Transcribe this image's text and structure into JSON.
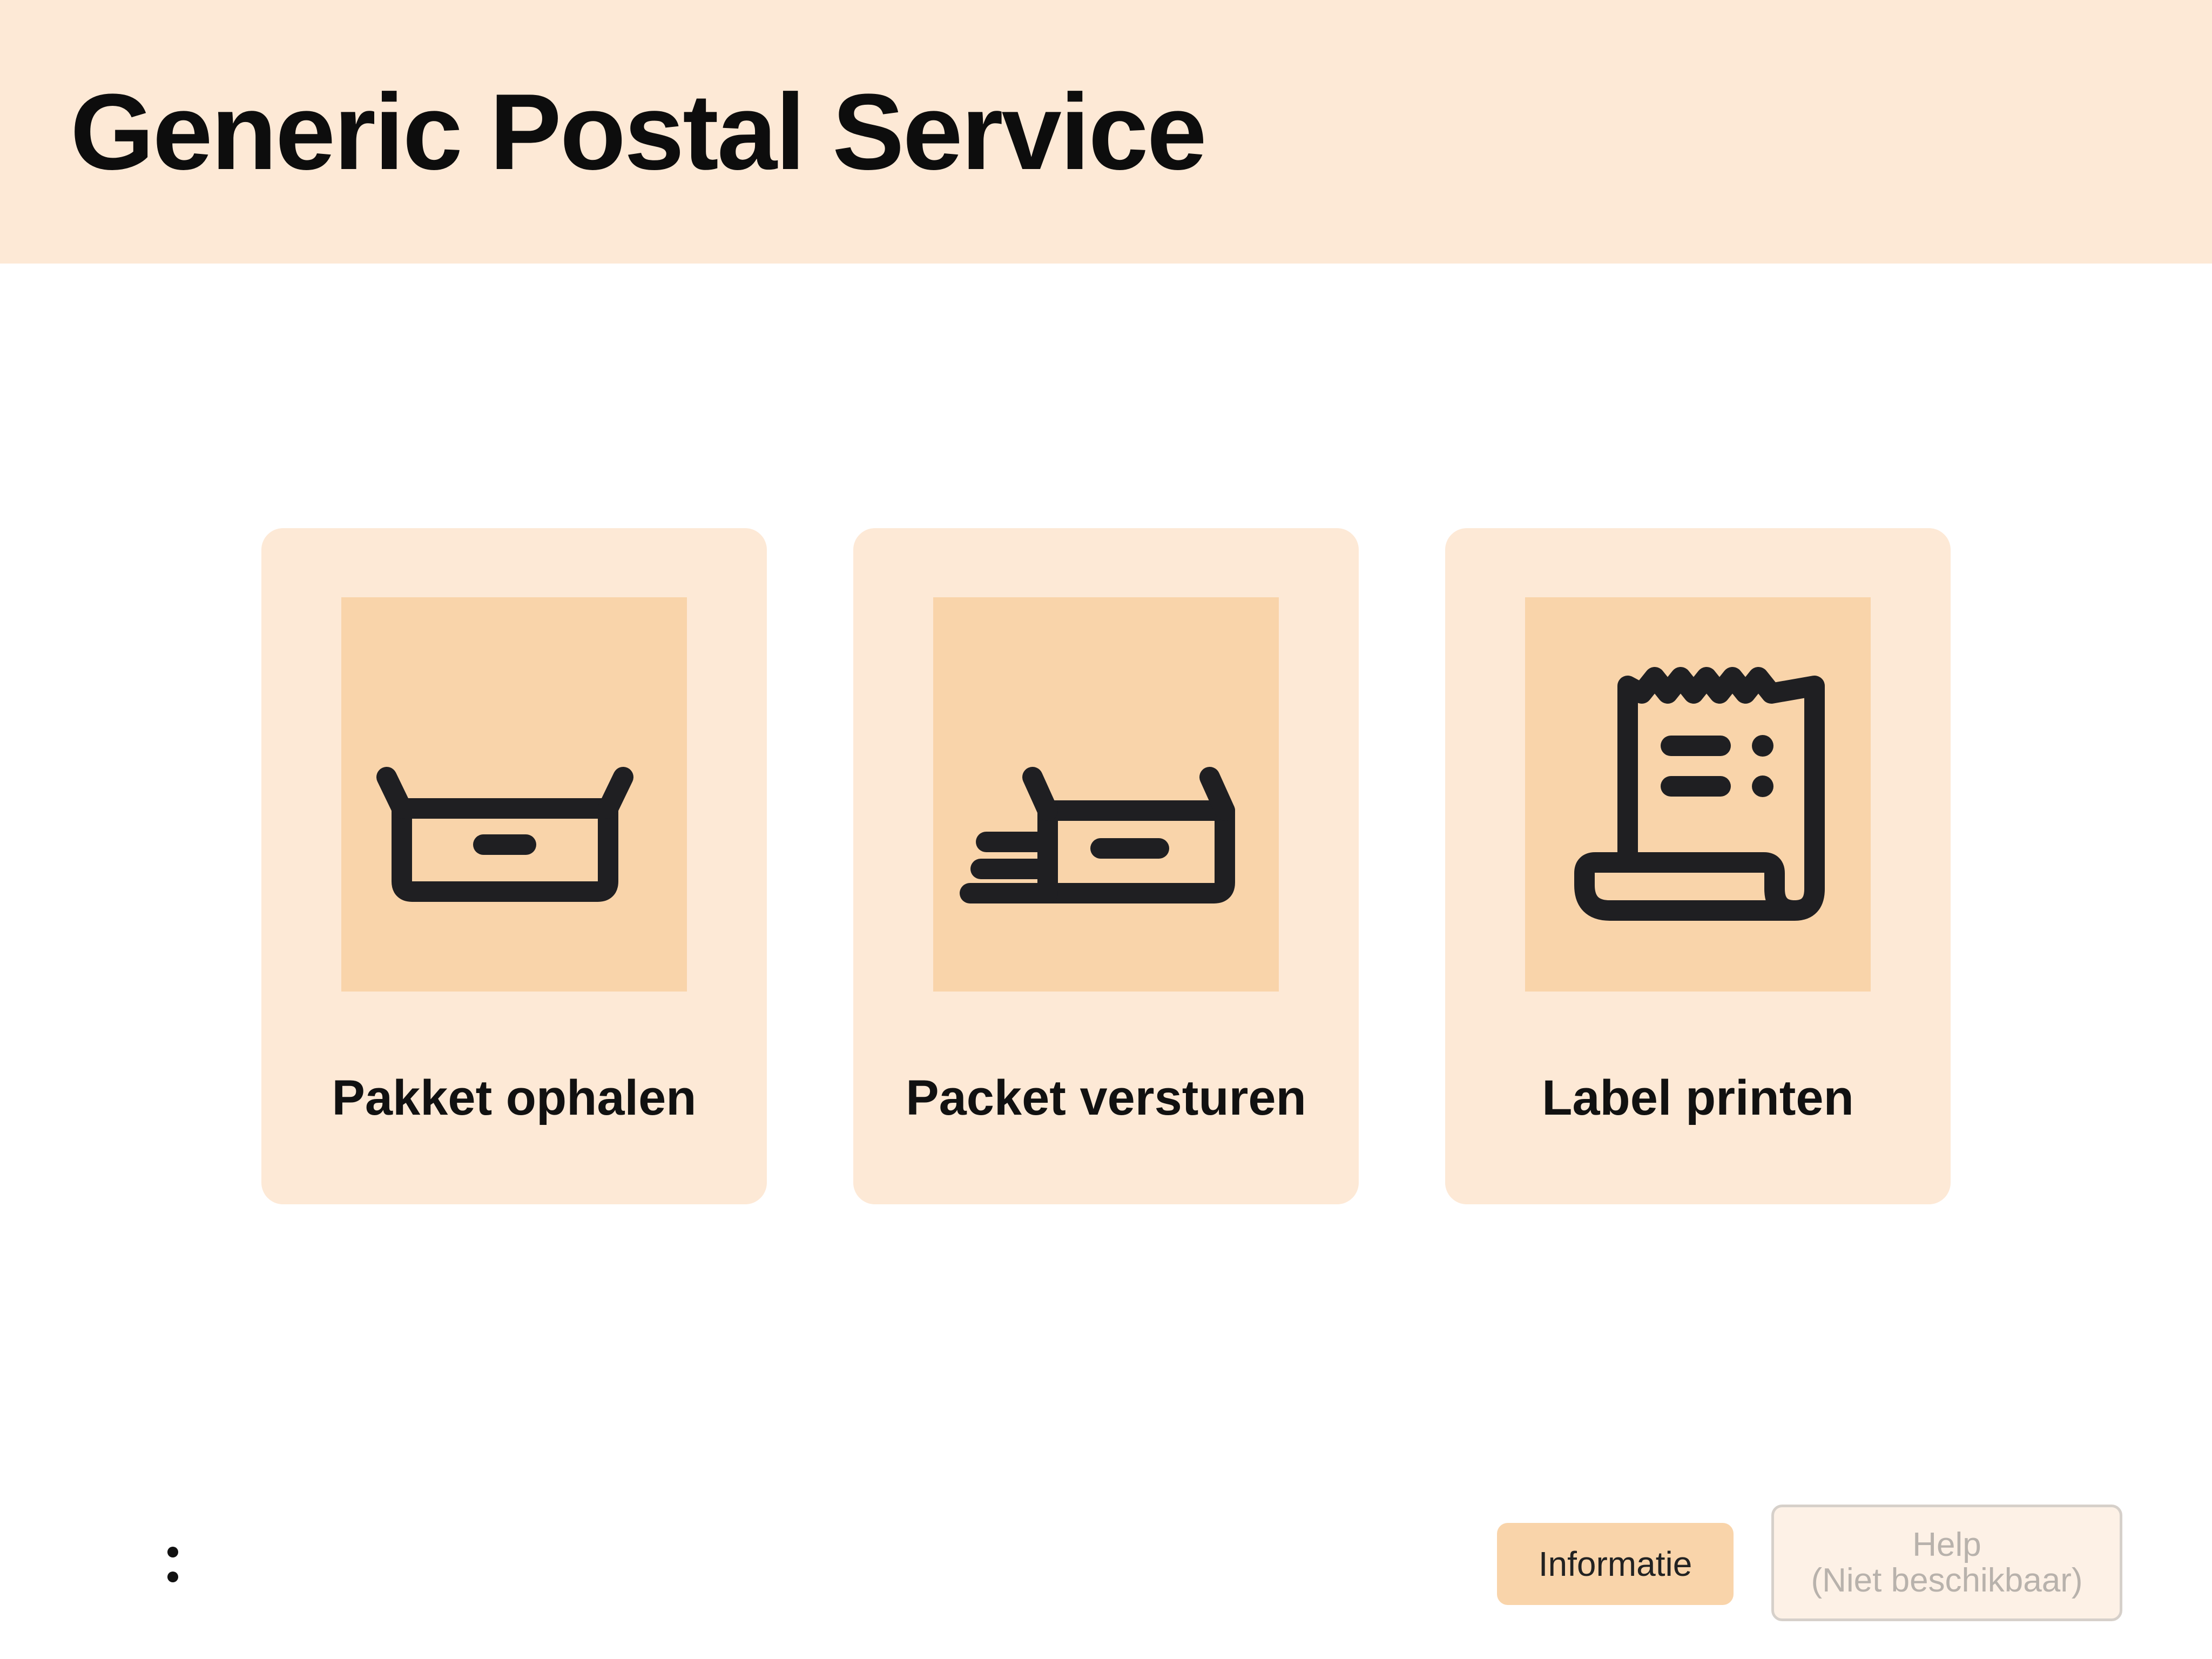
{
  "header": {
    "title": "Generic Postal Service"
  },
  "tiles": [
    {
      "label": "Pakket ophalen",
      "icon": "open-box-icon"
    },
    {
      "label": "Packet versturen",
      "icon": "sending-box-icon"
    },
    {
      "label": "Label printen",
      "icon": "receipt-icon"
    }
  ],
  "footer": {
    "menu_icon": "vertical-dots-icon",
    "info_label": "Informatie",
    "help_label": "Help",
    "help_status": "(Niet beschikbaar)"
  },
  "colors": {
    "header_background": "#fde9d6",
    "tile_background": "#fde9d6",
    "icon_background": "#f9d4aa",
    "icon_stroke": "#1f1f22",
    "disabled_text": "#b8b2ac"
  }
}
